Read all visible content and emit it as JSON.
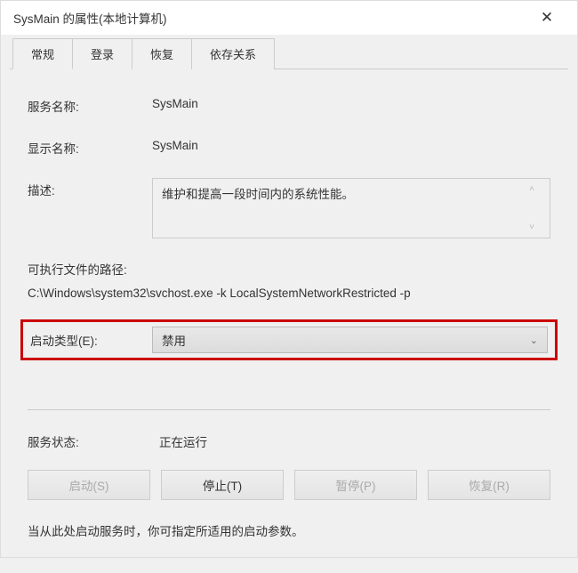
{
  "titlebar": {
    "title": "SysMain 的属性(本地计算机)"
  },
  "tabs": {
    "general": "常规",
    "logon": "登录",
    "recovery": "恢复",
    "dependencies": "依存关系"
  },
  "labels": {
    "serviceName": "服务名称:",
    "displayName": "显示名称:",
    "description": "描述:",
    "exePathLabel": "可执行文件的路径:",
    "startupType": "启动类型(E):",
    "serviceStatus": "服务状态:"
  },
  "values": {
    "serviceName": "SysMain",
    "displayName": "SysMain",
    "description": "维护和提高一段时间内的系统性能。",
    "exePath": "C:\\Windows\\system32\\svchost.exe -k LocalSystemNetworkRestricted -p",
    "startupType": "禁用",
    "serviceStatus": "正在运行"
  },
  "buttons": {
    "start": "启动(S)",
    "stop": "停止(T)",
    "pause": "暂停(P)",
    "resume": "恢复(R)"
  },
  "hint": "当从此处启动服务时，你可指定所适用的启动参数。"
}
